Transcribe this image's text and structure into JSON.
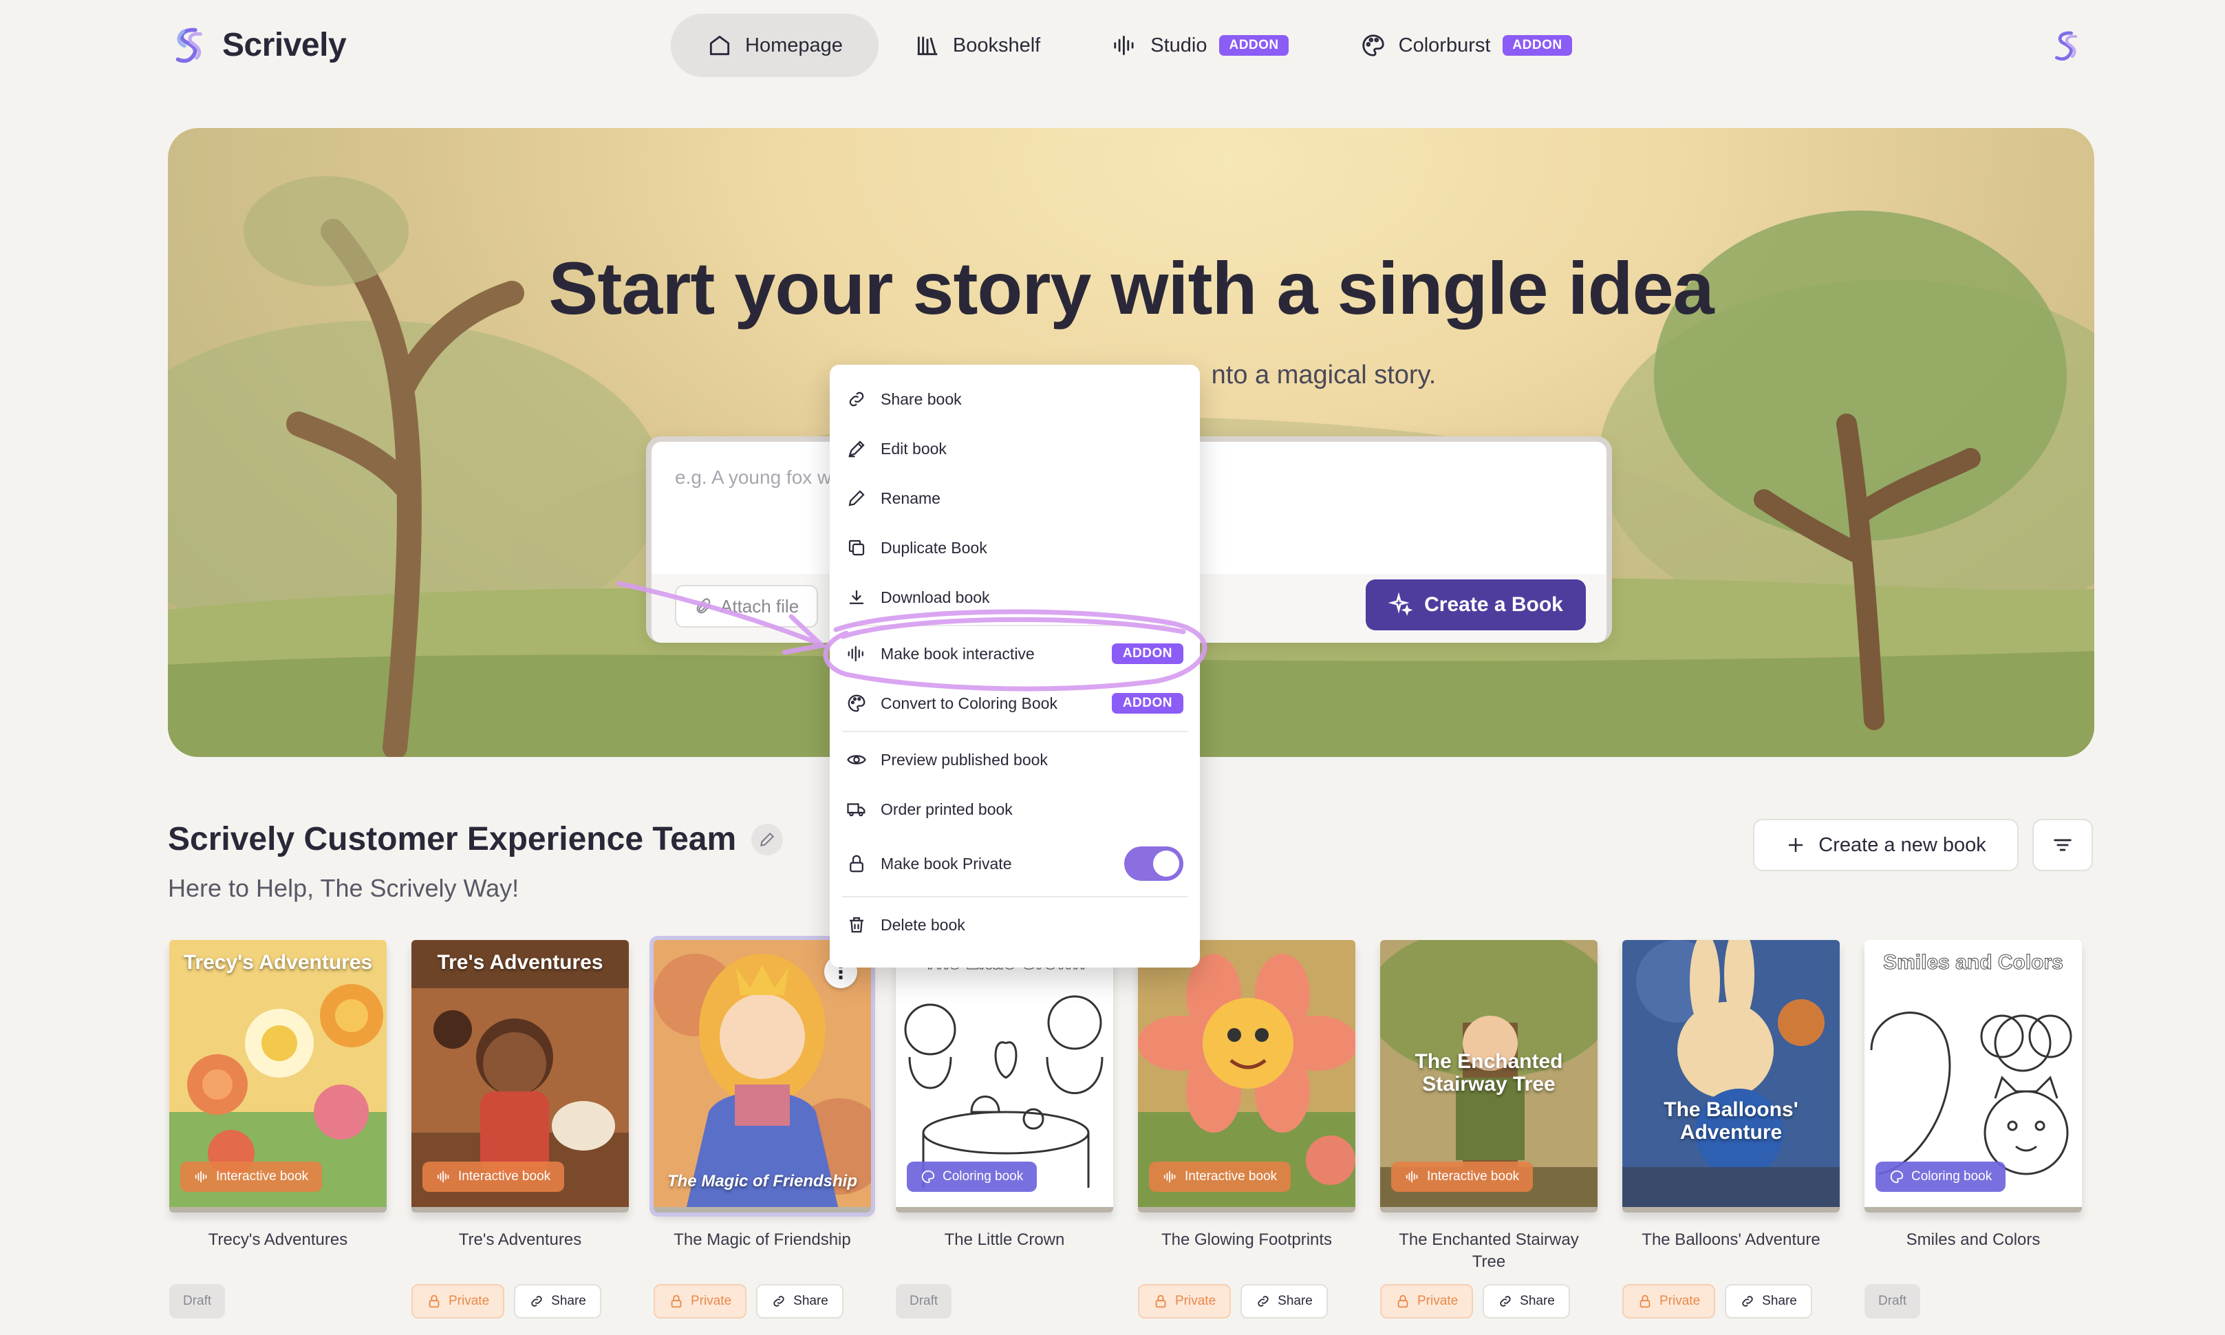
{
  "app": {
    "name": "Scrively"
  },
  "nav": {
    "items": [
      {
        "label": "Homepage",
        "active": true
      },
      {
        "label": "Bookshelf"
      },
      {
        "label": "Studio",
        "badge": "ADDON"
      },
      {
        "label": "Colorburst",
        "badge": "ADDON"
      }
    ]
  },
  "hero": {
    "title": "Start your story with a single idea",
    "subtitle_visible": "nto a magical story.",
    "placeholder": "e.g. A young fox w",
    "attach_label": "Attach file",
    "create_label": "Create a Book"
  },
  "section": {
    "title": "Scrively Customer Experience Team",
    "subtitle": "Here to Help, The Scrively Way!",
    "new_book_label": "Create a new book"
  },
  "menu": {
    "items": [
      {
        "label": "Share book",
        "icon": "link-icon"
      },
      {
        "label": "Edit book",
        "icon": "pen-icon"
      },
      {
        "label": "Rename",
        "icon": "pencil-icon"
      },
      {
        "label": "Duplicate Book",
        "icon": "copy-icon"
      },
      {
        "label": "Download book",
        "icon": "download-icon"
      },
      {
        "label": "Make book interactive",
        "icon": "audio-wave-icon",
        "badge": "ADDON"
      },
      {
        "label": "Convert to Coloring Book",
        "icon": "palette-icon",
        "badge": "ADDON"
      },
      {
        "label": "Preview published book",
        "icon": "eye-icon"
      },
      {
        "label": "Order printed book",
        "icon": "truck-icon"
      },
      {
        "label": "Make book Private",
        "icon": "lock-icon",
        "toggle": true
      },
      {
        "label": "Delete book",
        "icon": "trash-icon"
      }
    ]
  },
  "books": [
    {
      "title": "Trecy's Adventures",
      "cover_title": "Trecy's Adventures",
      "type": "Interactive book",
      "status": "Draft",
      "palette": [
        "#f2d27a",
        "#a9c96c",
        "#e9844f"
      ]
    },
    {
      "title": "Tre's Adventures",
      "cover_title": "Tre's Adventures",
      "type": "Interactive book",
      "status": "Private",
      "share": "Share",
      "palette": [
        "#7a4a2b",
        "#c9895a",
        "#e8b478"
      ]
    },
    {
      "title": "The Magic of Friendship",
      "cover_title": "The Magic of Friendship",
      "type": "",
      "status": "Private",
      "share": "Share",
      "palette": [
        "#f0b46a",
        "#d97b63",
        "#8a7fb5"
      ]
    },
    {
      "title": "The Little Crown",
      "cover_title": "The Little Crown",
      "type": "Coloring book",
      "status": "Draft",
      "palette": [
        "#ffffff",
        "#f2f2f2",
        "#dcdcdc"
      ]
    },
    {
      "title": "The Glowing Footprints",
      "cover_title": "",
      "type": "Interactive book",
      "status": "Private",
      "share": "Share",
      "palette": [
        "#8fae54",
        "#e9826a",
        "#f6c56b"
      ]
    },
    {
      "title": "The Enchanted Stairway Tree",
      "cover_title": "The Enchanted Stairway Tree",
      "type": "Interactive book",
      "status": "Private",
      "share": "Share",
      "palette": [
        "#8a8a4a",
        "#b8a26a",
        "#d4c08c"
      ]
    },
    {
      "title": "The Balloons' Adventure",
      "cover_title": "The Balloons' Adventure",
      "type": "",
      "status": "Private",
      "share": "Share",
      "palette": [
        "#4c6fa8",
        "#e3b07a",
        "#f0d6a8"
      ]
    },
    {
      "title": "Smiles and Colors",
      "cover_title": "Smiles and Colors",
      "type": "Coloring book",
      "status": "Draft",
      "palette": [
        "#ffffff",
        "#f4f4f4",
        "#d8d8d8"
      ]
    }
  ],
  "colors": {
    "accent": "#8b5cf6",
    "create": "#4f3d9e",
    "private": "#e88a4c",
    "annotation": "#d59cf0"
  }
}
